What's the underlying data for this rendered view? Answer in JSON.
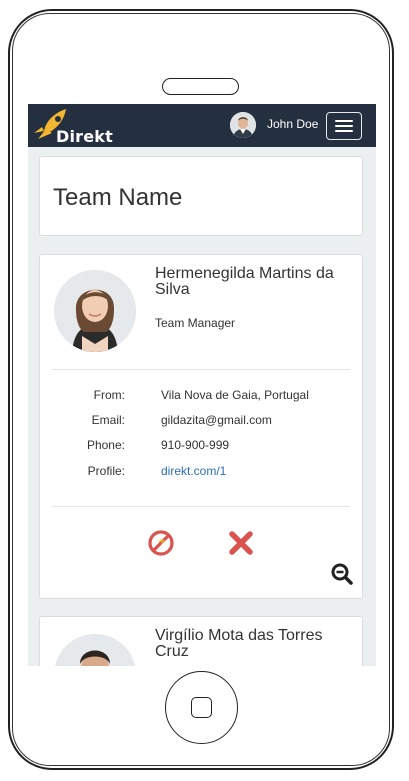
{
  "navbar": {
    "brand": "Direkt",
    "user_name": "John Doe"
  },
  "team": {
    "name": "Team Name"
  },
  "members": [
    {
      "name": "Hermenegilda Martins da Silva",
      "role": "Team Manager",
      "details": [
        {
          "label": "From:",
          "value": "Vila Nova de Gaia, Portugal"
        },
        {
          "label": "Email:",
          "value": "gildazita@gmail.com"
        },
        {
          "label": "Phone:",
          "value": "910-900-999"
        },
        {
          "label": "Profile:",
          "value": "direkt.com/1"
        }
      ]
    },
    {
      "name": "Virgílio Mota das Torres Cruz"
    }
  ],
  "icons": {
    "brand": "rocket-icon",
    "menu": "hamburger-menu-icon",
    "block": "block-icon",
    "remove": "close-icon",
    "zoom_out": "zoom-out-icon"
  },
  "colors": {
    "navbar_bg": "#243040",
    "accent_red": "#d9534f",
    "brand_yellow": "#f2b631",
    "link": "#2a6fb5"
  }
}
